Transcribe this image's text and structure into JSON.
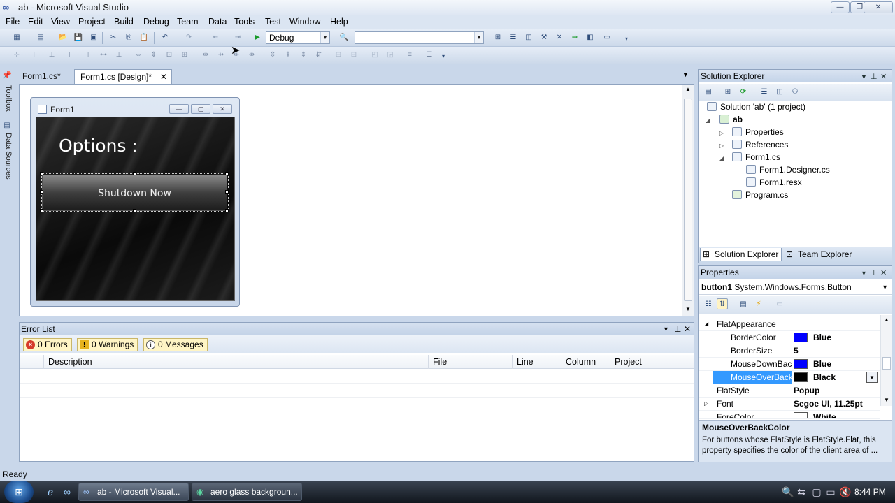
{
  "window": {
    "title": "ab - Microsoft Visual Studio"
  },
  "menu": [
    "File",
    "Edit",
    "View",
    "Project",
    "Build",
    "Debug",
    "Team",
    "Data",
    "Tools",
    "Test",
    "Window",
    "Help"
  ],
  "toolbar": {
    "config": "Debug",
    "platform": ""
  },
  "left_strip": {
    "toolbox": "Toolbox",
    "data_sources": "Data Sources"
  },
  "doc_tabs": [
    {
      "label": "Form1.cs*"
    },
    {
      "label": "Form1.cs [Design]*"
    }
  ],
  "designer": {
    "form_title": "Form1",
    "options_label": "Options :",
    "button_text": "Shutdown Now"
  },
  "error_list": {
    "title": "Error List",
    "filters": {
      "errors": "0 Errors",
      "warnings": "0 Warnings",
      "messages": "0 Messages"
    },
    "columns": [
      "Description",
      "File",
      "Line",
      "Column",
      "Project"
    ]
  },
  "solution_explorer": {
    "title": "Solution Explorer",
    "tree": {
      "solution": "Solution 'ab' (1 project)",
      "project": "ab",
      "properties": "Properties",
      "references": "References",
      "form": "Form1.cs",
      "designer_file": "Form1.Designer.cs",
      "resx": "Form1.resx",
      "program": "Program.cs"
    },
    "tabs": [
      "Solution Explorer",
      "Team Explorer"
    ]
  },
  "properties": {
    "title": "Properties",
    "object": "button1",
    "object_type": "System.Windows.Forms.Button",
    "rows": [
      {
        "name": "FlatAppearance",
        "value": ""
      },
      {
        "name": "BorderColor",
        "value": "Blue",
        "color": "#0000ff"
      },
      {
        "name": "BorderSize",
        "value": "5"
      },
      {
        "name": "MouseDownBac",
        "value": "Blue",
        "color": "#0000ff"
      },
      {
        "name": "MouseOverBack",
        "value": "Black",
        "color": "#000000"
      },
      {
        "name": "FlatStyle",
        "value": "Popup"
      },
      {
        "name": "Font",
        "value": "Segoe UI, 11.25pt"
      },
      {
        "name": "ForeColor",
        "value": "White",
        "color": "#ffffff"
      }
    ],
    "desc_title": "MouseOverBackColor",
    "desc_text": "For buttons whose FlatStyle is FlatStyle.Flat, this property specifies the color of the client area of ..."
  },
  "status": "Ready",
  "taskbar": {
    "tasks": [
      "ab - Microsoft Visual...",
      "aero glass backgroun..."
    ],
    "clock": "8:44 PM"
  },
  "icons": {
    "vs_logo": "visual-studio-icon",
    "start": "windows-orb-icon"
  }
}
